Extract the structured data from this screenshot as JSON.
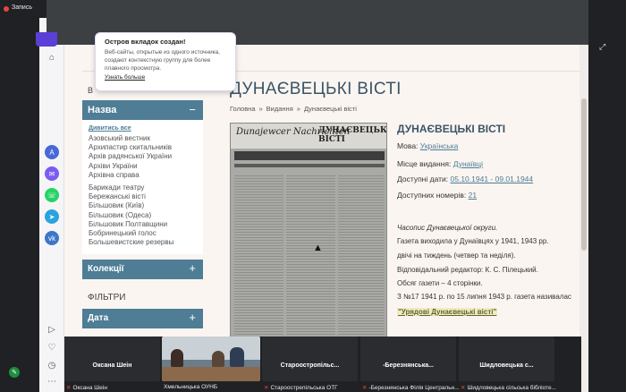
{
  "meeting": {
    "recording_label": "Запись",
    "participants": [
      {
        "tile_name": "Оксана Шеін",
        "footer": "Оксана Шеін"
      },
      {
        "tile_name": "",
        "footer": "Хмельницька ОУНБ"
      },
      {
        "tile_name": "Староостропільс...",
        "footer": "Староострепільська ОТГ"
      },
      {
        "tile_name": "-Березнянська...",
        "footer": "-Березнянська Філія Центральн..."
      },
      {
        "tile_name": "Шидловецька с...",
        "footer": "Шидловецька сільська бібліоте..."
      }
    ]
  },
  "popup": {
    "title": "Остров вкладок создан!",
    "text": "Веб-сайты, открытые из одного источника, создают контекстную группу для более плавного просмотра.",
    "link": "Узнать больше"
  },
  "sidebar": {
    "letter": "В",
    "name_header": "Назва",
    "name_header_symbol": "−",
    "show_all": "Дивитись всe",
    "titles": [
      "Азовський вестник",
      "Архипастир скитальників",
      "Архів радянської України",
      "Архіви України",
      "Архівна справа",
      "",
      "Барикади театру",
      "Бережанські вісті",
      "Більшовик (Київ)",
      "Більшовик (Одеса)",
      "Більшовик Полтавщини",
      "Бобринецький голос",
      "Большевистские резервы"
    ],
    "collections_header": "Колекції",
    "filters_label": "ФІЛЬТРИ",
    "date_header": "Дата",
    "plus_symbol": "+"
  },
  "main": {
    "page_title": "ДУНАЄВЕЦЬКІ ВІСТІ",
    "breadcrumb": [
      "Головна",
      "Видання",
      "Дунаєвецькі вісті"
    ],
    "breadcrumb_sep": "»",
    "newspaper_image": {
      "masthead_left": "Dunajewcer Nachrichten",
      "masthead_right": "ДУНАЄВЕЦЬКІ ВІСТІ"
    },
    "info_title": "ДУНАЄВЕЦЬКІ ВІСТІ",
    "language_label": "Мова:",
    "language_value": "Українська",
    "place_label": "Місце видання:",
    "place_value": "Дунаївці",
    "dates_label": "Доступні дати:",
    "dates_value": "05.10.1941 - 09.01.1944",
    "issues_label": "Доступних номерів:",
    "issues_value": "21",
    "description": [
      "Часопис Дунаєвецької округи.",
      "Газета виходила у Дунаївцях у 1941, 1943 рр.",
      "двічі на тиждень (четвер та неділя).",
      "Відповідальний редактор: К. С. Пілецький.",
      "Обсяг газети – 4 сторінки.",
      "З №17 1941 р. по 15 липня 1943 р. газета називалас"
    ],
    "description_link": "\"Урядові Дунаєвецькі вісті\""
  }
}
